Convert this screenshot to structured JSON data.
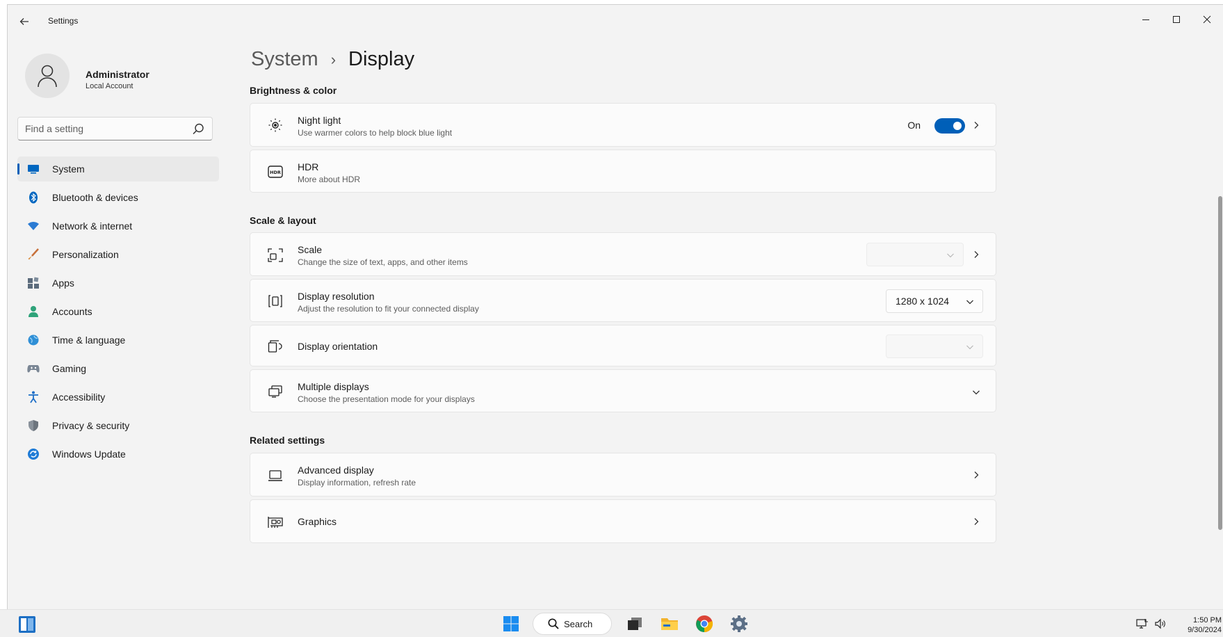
{
  "window": {
    "app_title": "Settings"
  },
  "profile": {
    "name": "Administrator",
    "account_type": "Local Account"
  },
  "search": {
    "placeholder": "Find a setting"
  },
  "sidebar": {
    "items": [
      {
        "label": "System",
        "icon": "monitor-icon",
        "active": true
      },
      {
        "label": "Bluetooth & devices",
        "icon": "bluetooth-icon"
      },
      {
        "label": "Network & internet",
        "icon": "wifi-icon"
      },
      {
        "label": "Personalization",
        "icon": "brush-icon"
      },
      {
        "label": "Apps",
        "icon": "apps-icon"
      },
      {
        "label": "Accounts",
        "icon": "person-icon"
      },
      {
        "label": "Time & language",
        "icon": "globe-clock-icon"
      },
      {
        "label": "Gaming",
        "icon": "gamepad-icon"
      },
      {
        "label": "Accessibility",
        "icon": "accessibility-icon"
      },
      {
        "label": "Privacy & security",
        "icon": "shield-icon"
      },
      {
        "label": "Windows Update",
        "icon": "update-icon"
      }
    ]
  },
  "breadcrumb": {
    "parent": "System",
    "separator": "›",
    "current": "Display"
  },
  "sections": {
    "brightness": {
      "title": "Brightness & color",
      "night_light": {
        "title": "Night light",
        "subtitle": "Use warmer colors to help block blue light",
        "state_label": "On",
        "enabled": true
      },
      "hdr": {
        "title": "HDR",
        "subtitle": "More about HDR"
      }
    },
    "scale_layout": {
      "title": "Scale & layout",
      "scale": {
        "title": "Scale",
        "subtitle": "Change the size of text, apps, and other items",
        "value": ""
      },
      "resolution": {
        "title": "Display resolution",
        "subtitle": "Adjust the resolution to fit your connected display",
        "value": "1280 x 1024"
      },
      "orientation": {
        "title": "Display orientation",
        "value": ""
      },
      "multiple": {
        "title": "Multiple displays",
        "subtitle": "Choose the presentation mode for your displays"
      }
    },
    "related": {
      "title": "Related settings",
      "advanced": {
        "title": "Advanced display",
        "subtitle": "Display information, refresh rate"
      },
      "graphics": {
        "title": "Graphics"
      }
    }
  },
  "taskbar": {
    "search_label": "Search",
    "time": "1:50 PM",
    "date": "9/30/2024"
  },
  "colors": {
    "accent": "#005fb8",
    "window_bg": "#f3f3f3",
    "card_bg": "#fbfbfb"
  }
}
